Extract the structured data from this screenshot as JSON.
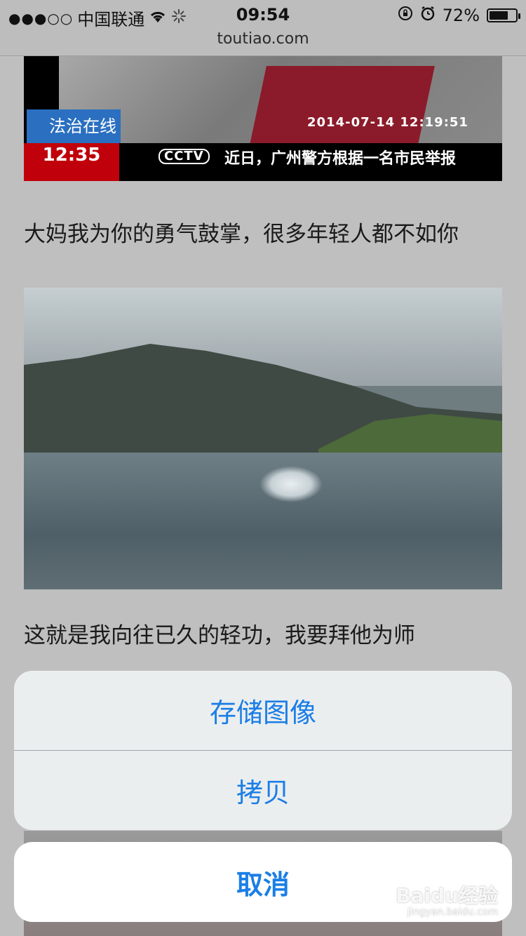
{
  "status_bar": {
    "signal": "●●●○○",
    "carrier": "中国联通",
    "time": "09:54",
    "battery_percent": "72%",
    "battery_level": 0.72,
    "icons": [
      "wifi-icon",
      "loading-spinner-icon",
      "orientation-lock-icon",
      "alarm-icon",
      "battery-icon"
    ]
  },
  "browser": {
    "url": "toutiao.com"
  },
  "article": {
    "video_frame": {
      "label": "法治在线",
      "clock": "12:35",
      "datetime": "2014-07-14 12:19:51",
      "channel_logo": "CCTV",
      "ticker": "近日，广州警方根据一名市民举报"
    },
    "paragraph_1": "大妈我为你的勇气鼓掌，很多年轻人都不如你",
    "paragraph_2": "这就是我向往已久的轻功，我要拜他为师"
  },
  "action_sheet": {
    "save_image": "存储图像",
    "copy": "拷贝",
    "cancel": "取消",
    "accent_color": "#1a7ee6"
  },
  "watermark": {
    "main": "Baidu经验",
    "sub": "jingyan.baidu.com"
  }
}
